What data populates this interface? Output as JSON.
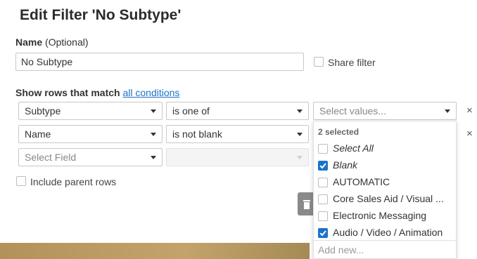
{
  "dialog": {
    "title": "Edit Filter 'No Subtype'"
  },
  "name_field": {
    "label": "Name",
    "optional": "(Optional)",
    "value": "No Subtype"
  },
  "share": {
    "label": "Share filter",
    "checked": false
  },
  "match": {
    "prefix": "Show rows that match",
    "link": "all conditions"
  },
  "rows": [
    {
      "field": "Subtype",
      "operator": "is one of",
      "value_placeholder": "Select values..."
    },
    {
      "field": "Name",
      "operator": "is not blank"
    },
    {
      "field_placeholder": "Select Field",
      "operator": ""
    }
  ],
  "include_parent": {
    "label": "Include parent rows",
    "checked": false
  },
  "dropdown": {
    "header": "2 selected",
    "options": [
      {
        "label": "Select All",
        "checked": false,
        "italic": true
      },
      {
        "label": "Blank",
        "checked": true,
        "italic": true
      },
      {
        "label": "AUTOMATIC",
        "checked": false,
        "italic": false
      },
      {
        "label": "Core Sales Aid / Visual ...",
        "checked": false,
        "italic": false
      },
      {
        "label": "Electronic Messaging",
        "checked": false,
        "italic": false
      },
      {
        "label": "Audio / Video / Animation",
        "checked": true,
        "italic": false
      }
    ],
    "add_new_placeholder": "Add new..."
  },
  "icons": {
    "remove": "×",
    "trash": "trash-icon",
    "check": "check-icon",
    "dropdown_caret": "chevron-down-icon"
  },
  "colors": {
    "accent": "#1a73c9"
  }
}
